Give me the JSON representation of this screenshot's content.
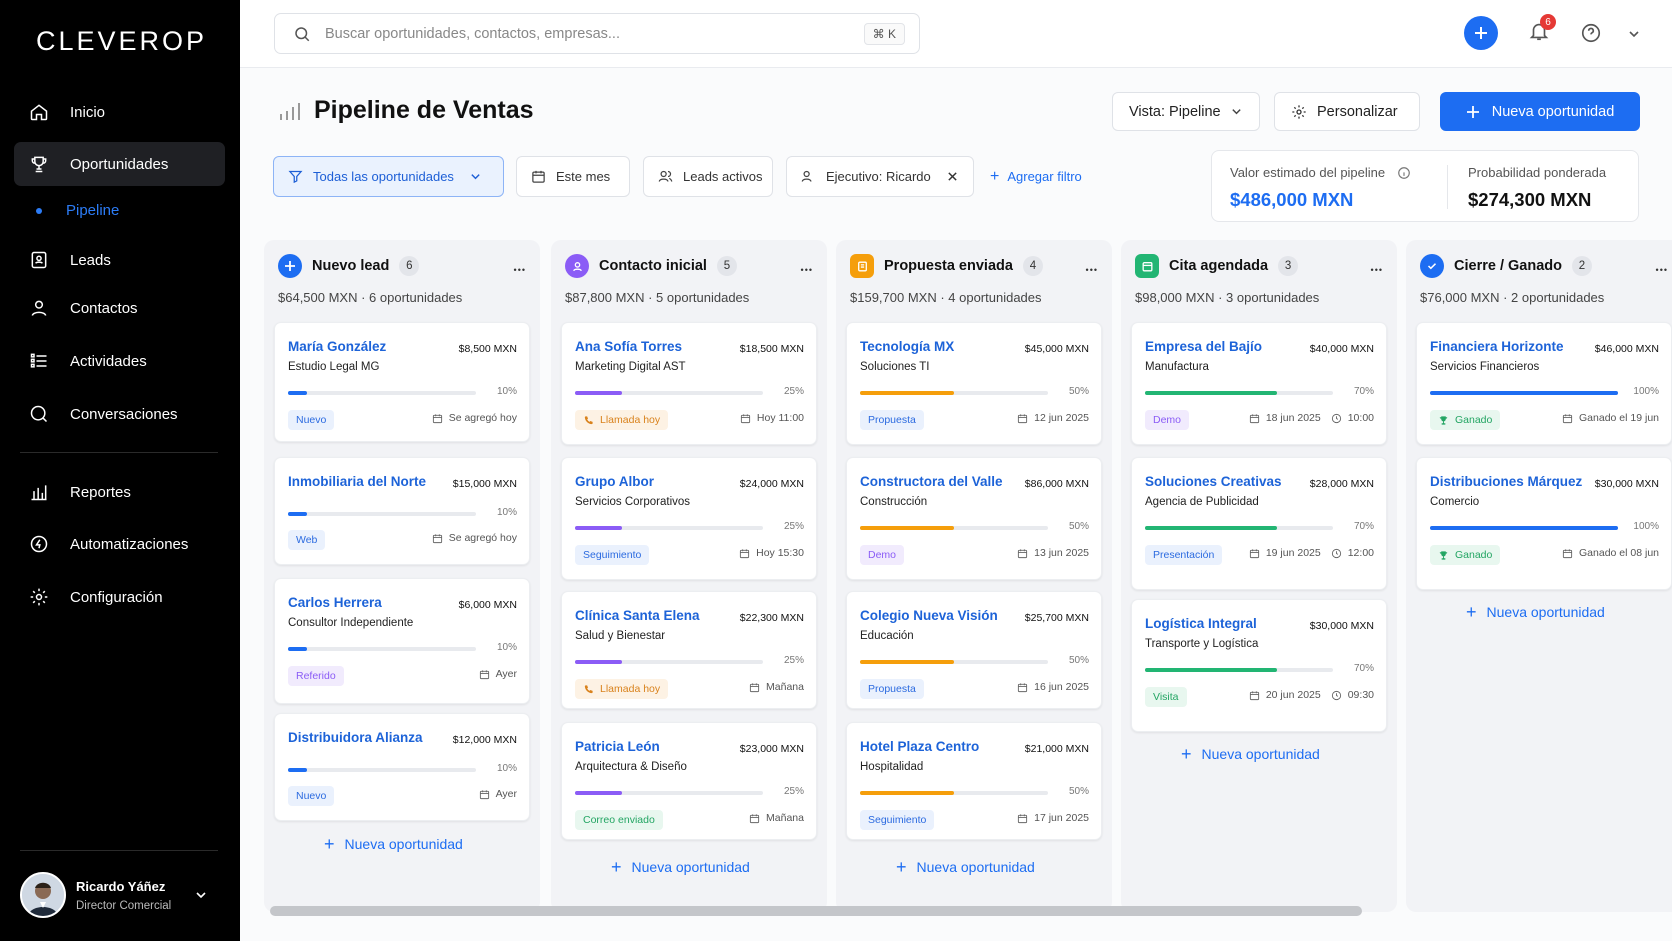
{
  "app": {
    "logo": "CLEVEROP"
  },
  "sidebar": {
    "items": [
      {
        "label": "Inicio",
        "icon": "home-icon"
      },
      {
        "label": "Oportunidades",
        "icon": "trophy-icon"
      },
      {
        "label": "Leads",
        "icon": "leads-icon"
      },
      {
        "label": "Contactos",
        "icon": "user-icon"
      },
      {
        "label": "Actividades",
        "icon": "list-icon"
      },
      {
        "label": "Conversaciones",
        "icon": "chat-icon"
      },
      {
        "label": "Reportes",
        "icon": "chart-icon"
      },
      {
        "label": "Automatizaciones",
        "icon": "automation-icon"
      },
      {
        "label": "Configuración",
        "icon": "gear-icon"
      }
    ],
    "sub_item": "Pipeline",
    "user": {
      "name": "Ricardo Yáñez",
      "role": "Director Comercial"
    }
  },
  "topbar": {
    "search_placeholder": "Buscar oportunidades, contactos, empresas...",
    "shortcut": "⌘ K",
    "notifications": "6"
  },
  "header": {
    "title": "Pipeline de Ventas",
    "view_label": "Vista: Pipeline",
    "customize_label": "Personalizar",
    "new_label": "Nueva oportunidad"
  },
  "filters": {
    "all": "Todas las oportunidades",
    "month": "Este mes",
    "leads": "Leads activos",
    "exec": "Ejecutivo: Ricardo",
    "add": "Agregar filtro"
  },
  "stats": {
    "pipeline_label": "Valor estimado del pipeline",
    "pipeline_value": "$486,000 MXN",
    "weighted_label": "Probabilidad ponderada",
    "weighted_value": "$274,300 MXN"
  },
  "colors": {
    "accent": "#1d6df2",
    "blue": "#1d6df2",
    "purple": "#8b5cf6",
    "orange": "#f59e0b",
    "green": "#22b573"
  },
  "new_opportunity": "Nueva oportunidad",
  "columns": [
    {
      "title": "Nuevo lead",
      "count": "6",
      "summary": "$64,500 MXN · 6 oportunidades",
      "color": "#1d6df2",
      "icon": "plus-icon",
      "cards": [
        {
          "name": "María González",
          "amount": "$8,500 MXN",
          "company": "Estudio Legal MG",
          "progress": 10,
          "pct": "10%",
          "tag": "Nuevo",
          "tag_style": "blue",
          "date": "Se agregó hoy"
        },
        {
          "name": "Inmobiliaria del Norte",
          "amount": "$15,000 MXN",
          "company": "",
          "progress": 10,
          "pct": "10%",
          "tag": "Web",
          "tag_style": "blue",
          "date": "Se agregó hoy"
        },
        {
          "name": "Carlos Herrera",
          "amount": "$6,000 MXN",
          "company": "Consultor Independiente",
          "progress": 10,
          "pct": "10%",
          "tag": "Referido",
          "tag_style": "purple",
          "date": "Ayer"
        },
        {
          "name": "Distribuidora Alianza",
          "amount": "$12,000 MXN",
          "company": "",
          "progress": 10,
          "pct": "10%",
          "tag": "Nuevo",
          "tag_style": "blue",
          "date": "Ayer"
        }
      ]
    },
    {
      "title": "Contacto inicial",
      "count": "5",
      "summary": "$87,800 MXN · 5 oportunidades",
      "color": "#8b5cf6",
      "icon": "contact-icon",
      "cards": [
        {
          "name": "Ana Sofía Torres",
          "amount": "$18,500 MXN",
          "company": "Marketing Digital AST",
          "progress": 25,
          "pct": "25%",
          "tag": "Llamada hoy",
          "tag_style": "orange",
          "tag_icon": "phone",
          "date": "Hoy 11:00"
        },
        {
          "name": "Grupo Albor",
          "amount": "$24,000 MXN",
          "company": "Servicios Corporativos",
          "progress": 25,
          "pct": "25%",
          "tag": "Seguimiento",
          "tag_style": "blue",
          "date": "Hoy 15:30"
        },
        {
          "name": "Clínica Santa Elena",
          "amount": "$22,300 MXN",
          "company": "Salud y Bienestar",
          "progress": 25,
          "pct": "25%",
          "tag": "Llamada hoy",
          "tag_style": "orange",
          "tag_icon": "phone",
          "date": "Mañana"
        },
        {
          "name": "Patricia León",
          "amount": "$23,000 MXN",
          "company": "Arquitectura & Diseño",
          "progress": 25,
          "pct": "25%",
          "tag": "Correo enviado",
          "tag_style": "green",
          "date": "Mañana"
        }
      ]
    },
    {
      "title": "Propuesta enviada",
      "count": "4",
      "summary": "$159,700 MXN · 4 oportunidades",
      "color": "#f59e0b",
      "icon": "document-icon",
      "cards": [
        {
          "name": "Tecnología MX",
          "amount": "$45,000 MXN",
          "company": "Soluciones TI",
          "progress": 50,
          "pct": "50%",
          "tag": "Propuesta",
          "tag_style": "blue",
          "date": "12 jun 2025"
        },
        {
          "name": "Constructora del Valle",
          "amount": "$86,000 MXN",
          "company": "Construcción",
          "progress": 50,
          "pct": "50%",
          "tag": "Demo",
          "tag_style": "purple",
          "date": "13 jun 2025"
        },
        {
          "name": "Colegio Nueva Visión",
          "amount": "$25,700 MXN",
          "company": "Educación",
          "progress": 50,
          "pct": "50%",
          "tag": "Propuesta",
          "tag_style": "blue",
          "date": "16 jun 2025"
        },
        {
          "name": "Hotel Plaza Centro",
          "amount": "$21,000 MXN",
          "company": "Hospitalidad",
          "progress": 50,
          "pct": "50%",
          "tag": "Seguimiento",
          "tag_style": "blue",
          "date": "17 jun 2025"
        }
      ]
    },
    {
      "title": "Cita agendada",
      "count": "3",
      "summary": "$98,000 MXN · 3 oportunidades",
      "color": "#22b573",
      "icon": "calendar-icon",
      "cards": [
        {
          "name": "Empresa del Bajío",
          "amount": "$40,000 MXN",
          "company": "Manufactura",
          "progress": 70,
          "pct": "70%",
          "tag": "Demo",
          "tag_style": "purple",
          "date": "18 jun 2025",
          "time": "10:00"
        },
        {
          "name": "Soluciones Creativas",
          "amount": "$28,000 MXN",
          "company": "Agencia de Publicidad",
          "progress": 70,
          "pct": "70%",
          "tag": "Presentación",
          "tag_style": "blue",
          "date": "19 jun 2025",
          "time": "12:00"
        },
        {
          "name": "Logística Integral",
          "amount": "$30,000 MXN",
          "company": "Transporte y Logística",
          "progress": 70,
          "pct": "70%",
          "tag": "Visita",
          "tag_style": "green",
          "date": "20 jun 2025",
          "time": "09:30"
        }
      ]
    },
    {
      "title": "Cierre / Ganado",
      "count": "2",
      "summary": "$76,000 MXN · 2 oportunidades",
      "color": "#1d6df2",
      "icon": "check-circle-icon",
      "cards": [
        {
          "name": "Financiera Horizonte",
          "amount": "$46,000 MXN",
          "company": "Servicios Financieros",
          "progress": 100,
          "pct": "100%",
          "tag": "Ganado",
          "tag_style": "green",
          "tag_icon": "trophy",
          "date": "Ganado el 19 jun"
        },
        {
          "name": "Distribuciones Márquez",
          "amount": "$30,000 MXN",
          "company": "Comercio",
          "progress": 100,
          "pct": "100%",
          "tag": "Ganado",
          "tag_style": "green",
          "tag_icon": "trophy",
          "date": "Ganado el 08 jun"
        }
      ]
    }
  ]
}
